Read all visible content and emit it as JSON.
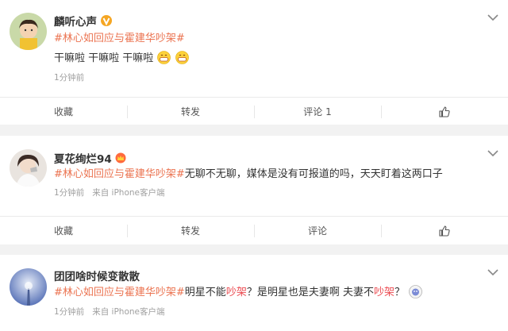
{
  "posts": [
    {
      "username": "麟听心声",
      "topic": "#林心如回应与霍建华吵架#",
      "lines": [
        "干嘛啦 干嘛啦 干嘛啦"
      ],
      "time": "1分钟前",
      "source": "",
      "actions": [
        "收藏",
        "转发",
        "评论 1",
        "like-icon"
      ]
    },
    {
      "username": "夏花绚烂94",
      "topic": "#林心如回应与霍建华吵架#",
      "text": "无聊不无聊，媒体是没有可报道的吗，天天盯着这两口子",
      "time": "1分钟前",
      "source": "来自 iPhone客户端",
      "actions": [
        "收藏",
        "转发",
        "评论",
        "like-icon"
      ]
    },
    {
      "username": "团团啥时候变散散",
      "topic": "#林心如回应与霍建华吵架#",
      "seg1": "明星不能",
      "kw1": "吵架",
      "seg2": "？是明星也是夫妻啊 夫妻不",
      "kw2": "吵架",
      "seg3": "？",
      "time": "1分钟前",
      "source": "来自 iPhone客户端"
    }
  ],
  "colors": {
    "topic": "#eb7350",
    "keyword": "#eb4c52",
    "meta": "#a0a0a0",
    "background": "#f2f2f2"
  }
}
